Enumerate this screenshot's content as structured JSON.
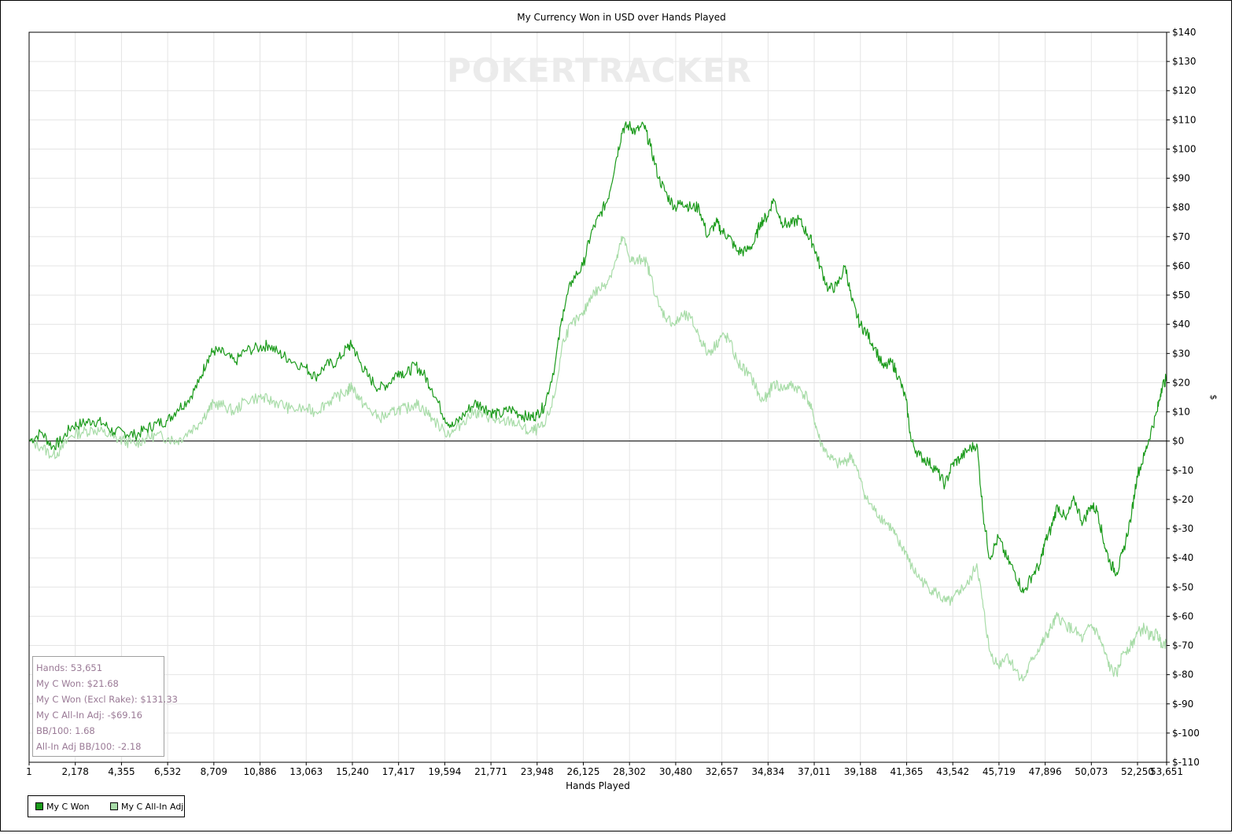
{
  "colors": {
    "won": "#1a9a1a",
    "allin": "#a8dca8",
    "grid": "#e4e4e4",
    "stats_text": "#9a7a96",
    "watermark": "#ebebeb"
  },
  "watermark": "POKERTRACKER",
  "chart_data": {
    "type": "line",
    "title": "My Currency Won in USD over Hands Played",
    "xlabel": "Hands Played",
    "ylabel": "$",
    "xlim": [
      1,
      53651
    ],
    "ylim": [
      -110,
      140
    ],
    "x_ticks": [
      "1",
      "2,178",
      "4,355",
      "6,532",
      "8,709",
      "10,886",
      "13,063",
      "15,240",
      "17,417",
      "19,594",
      "21,771",
      "23,948",
      "26,125",
      "28,302",
      "30,480",
      "32,657",
      "34,834",
      "37,011",
      "39,188",
      "41,365",
      "43,542",
      "45,719",
      "47,896",
      "50,073",
      "52,250",
      "53,651"
    ],
    "y_ticks": [
      "$140",
      "$130",
      "$120",
      "$110",
      "$100",
      "$90",
      "$80",
      "$70",
      "$60",
      "$50",
      "$40",
      "$30",
      "$20",
      "$10",
      "$0",
      "$-10",
      "$-20",
      "$-30",
      "$-40",
      "$-50",
      "$-60",
      "$-70",
      "$-80",
      "$-90",
      "$-100",
      "$-110"
    ],
    "grid": true,
    "legend_position": "bottom-left",
    "series": [
      {
        "name": "My C Won",
        "points": [
          [
            1,
            0
          ],
          [
            600,
            3
          ],
          [
            1100,
            -2
          ],
          [
            1500,
            0
          ],
          [
            2000,
            5
          ],
          [
            2500,
            6
          ],
          [
            3000,
            7
          ],
          [
            3500,
            6
          ],
          [
            4000,
            3
          ],
          [
            4500,
            3
          ],
          [
            5000,
            2
          ],
          [
            5500,
            4
          ],
          [
            6000,
            6
          ],
          [
            6532,
            7
          ],
          [
            7000,
            11
          ],
          [
            7500,
            14
          ],
          [
            8000,
            20
          ],
          [
            8400,
            28
          ],
          [
            8709,
            31
          ],
          [
            9200,
            30
          ],
          [
            9700,
            27
          ],
          [
            10200,
            31
          ],
          [
            10886,
            32
          ],
          [
            11300,
            33
          ],
          [
            11800,
            30
          ],
          [
            12300,
            28
          ],
          [
            13063,
            25
          ],
          [
            13500,
            22
          ],
          [
            14000,
            26
          ],
          [
            14500,
            27
          ],
          [
            15000,
            32
          ],
          [
            15240,
            33
          ],
          [
            15600,
            27
          ],
          [
            16000,
            22
          ],
          [
            16500,
            18
          ],
          [
            17000,
            20
          ],
          [
            17417,
            24
          ],
          [
            17800,
            23
          ],
          [
            18200,
            26
          ],
          [
            18600,
            23
          ],
          [
            19000,
            18
          ],
          [
            19594,
            8
          ],
          [
            20000,
            5
          ],
          [
            20500,
            9
          ],
          [
            21000,
            13
          ],
          [
            21400,
            12
          ],
          [
            21771,
            10
          ],
          [
            22200,
            9
          ],
          [
            22700,
            11
          ],
          [
            23200,
            9
          ],
          [
            23600,
            8
          ],
          [
            23948,
            9
          ],
          [
            24300,
            12
          ],
          [
            24800,
            26
          ],
          [
            25200,
            45
          ],
          [
            25600,
            55
          ],
          [
            26125,
            60
          ],
          [
            26500,
            71
          ],
          [
            26900,
            77
          ],
          [
            27300,
            83
          ],
          [
            27700,
            97
          ],
          [
            28000,
            107
          ],
          [
            28302,
            108
          ],
          [
            28600,
            106
          ],
          [
            29000,
            108
          ],
          [
            29300,
            101
          ],
          [
            29700,
            90
          ],
          [
            30100,
            84
          ],
          [
            30480,
            80
          ],
          [
            30800,
            82
          ],
          [
            31200,
            80
          ],
          [
            31600,
            80
          ],
          [
            32000,
            70
          ],
          [
            32400,
            75
          ],
          [
            32657,
            72
          ],
          [
            33000,
            70
          ],
          [
            33400,
            65
          ],
          [
            33800,
            65
          ],
          [
            34200,
            68
          ],
          [
            34500,
            75
          ],
          [
            34834,
            77
          ],
          [
            35100,
            83
          ],
          [
            35500,
            75
          ],
          [
            35900,
            74
          ],
          [
            36300,
            76
          ],
          [
            36700,
            71
          ],
          [
            37011,
            67
          ],
          [
            37300,
            60
          ],
          [
            37700,
            52
          ],
          [
            38100,
            53
          ],
          [
            38500,
            60
          ],
          [
            38800,
            48
          ],
          [
            39188,
            40
          ],
          [
            39500,
            37
          ],
          [
            39900,
            32
          ],
          [
            40300,
            25
          ],
          [
            40700,
            27
          ],
          [
            41000,
            22
          ],
          [
            41365,
            14
          ],
          [
            41600,
            0
          ],
          [
            42000,
            -5
          ],
          [
            42400,
            -7
          ],
          [
            42800,
            -10
          ],
          [
            43200,
            -15
          ],
          [
            43542,
            -8
          ],
          [
            43900,
            -6
          ],
          [
            44300,
            -3
          ],
          [
            44700,
            -1
          ],
          [
            45000,
            -25
          ],
          [
            45300,
            -40
          ],
          [
            45719,
            -33
          ],
          [
            46100,
            -40
          ],
          [
            46500,
            -45
          ],
          [
            46900,
            -52
          ],
          [
            47300,
            -46
          ],
          [
            47700,
            -42
          ],
          [
            47896,
            -35
          ],
          [
            48200,
            -30
          ],
          [
            48500,
            -22
          ],
          [
            48900,
            -27
          ],
          [
            49300,
            -20
          ],
          [
            49700,
            -28
          ],
          [
            50073,
            -22
          ],
          [
            50400,
            -24
          ],
          [
            50700,
            -35
          ],
          [
            51000,
            -42
          ],
          [
            51300,
            -45
          ],
          [
            51600,
            -38
          ],
          [
            52000,
            -25
          ],
          [
            52250,
            -12
          ],
          [
            52600,
            -5
          ],
          [
            52900,
            3
          ],
          [
            53200,
            10
          ],
          [
            53400,
            18
          ],
          [
            53651,
            21.68
          ]
        ]
      },
      {
        "name": "My C All-In Adj",
        "points": [
          [
            1,
            0
          ],
          [
            600,
            -2
          ],
          [
            1100,
            -5
          ],
          [
            1500,
            -3
          ],
          [
            2000,
            2
          ],
          [
            2500,
            3
          ],
          [
            3000,
            4
          ],
          [
            3500,
            3
          ],
          [
            4000,
            1
          ],
          [
            4500,
            0
          ],
          [
            5000,
            -1
          ],
          [
            5500,
            1
          ],
          [
            6000,
            2
          ],
          [
            6532,
            1
          ],
          [
            7000,
            0
          ],
          [
            7500,
            3
          ],
          [
            8000,
            6
          ],
          [
            8400,
            10
          ],
          [
            8709,
            13
          ],
          [
            9200,
            12
          ],
          [
            9700,
            10
          ],
          [
            10200,
            14
          ],
          [
            10886,
            15
          ],
          [
            11300,
            14
          ],
          [
            11800,
            13
          ],
          [
            12300,
            11
          ],
          [
            13063,
            11
          ],
          [
            13500,
            10
          ],
          [
            14000,
            13
          ],
          [
            14500,
            15
          ],
          [
            15000,
            17
          ],
          [
            15240,
            19
          ],
          [
            15600,
            14
          ],
          [
            16000,
            11
          ],
          [
            16500,
            8
          ],
          [
            17000,
            9
          ],
          [
            17417,
            11
          ],
          [
            17800,
            11
          ],
          [
            18200,
            13
          ],
          [
            18600,
            11
          ],
          [
            19000,
            8
          ],
          [
            19594,
            3
          ],
          [
            20000,
            3
          ],
          [
            20500,
            7
          ],
          [
            21000,
            10
          ],
          [
            21400,
            9
          ],
          [
            21771,
            8
          ],
          [
            22200,
            6
          ],
          [
            22700,
            7
          ],
          [
            23200,
            5
          ],
          [
            23600,
            3
          ],
          [
            23948,
            4
          ],
          [
            24300,
            5
          ],
          [
            24800,
            16
          ],
          [
            25200,
            35
          ],
          [
            25600,
            40
          ],
          [
            26125,
            43
          ],
          [
            26500,
            50
          ],
          [
            26900,
            52
          ],
          [
            27300,
            55
          ],
          [
            27700,
            62
          ],
          [
            28000,
            70
          ],
          [
            28302,
            63
          ],
          [
            28600,
            61
          ],
          [
            29000,
            63
          ],
          [
            29300,
            57
          ],
          [
            29700,
            46
          ],
          [
            30100,
            42
          ],
          [
            30480,
            40
          ],
          [
            30800,
            43
          ],
          [
            31200,
            42
          ],
          [
            31600,
            36
          ],
          [
            32000,
            30
          ],
          [
            32400,
            33
          ],
          [
            32657,
            36
          ],
          [
            33000,
            35
          ],
          [
            33400,
            27
          ],
          [
            33800,
            24
          ],
          [
            34200,
            20
          ],
          [
            34500,
            14
          ],
          [
            34834,
            15
          ],
          [
            35100,
            20
          ],
          [
            35500,
            18
          ],
          [
            35900,
            19
          ],
          [
            36300,
            18
          ],
          [
            36700,
            15
          ],
          [
            37011,
            8
          ],
          [
            37300,
            0
          ],
          [
            37700,
            -5
          ],
          [
            38100,
            -8
          ],
          [
            38500,
            -7
          ],
          [
            38800,
            -5
          ],
          [
            39188,
            -13
          ],
          [
            39500,
            -20
          ],
          [
            39900,
            -24
          ],
          [
            40300,
            -27
          ],
          [
            40700,
            -30
          ],
          [
            41000,
            -35
          ],
          [
            41365,
            -38
          ],
          [
            41600,
            -43
          ],
          [
            42000,
            -47
          ],
          [
            42400,
            -50
          ],
          [
            42800,
            -52
          ],
          [
            43200,
            -55
          ],
          [
            43542,
            -55
          ],
          [
            43900,
            -51
          ],
          [
            44300,
            -49
          ],
          [
            44700,
            -42
          ],
          [
            45000,
            -57
          ],
          [
            45300,
            -72
          ],
          [
            45719,
            -77
          ],
          [
            46100,
            -73
          ],
          [
            46500,
            -78
          ],
          [
            46900,
            -82
          ],
          [
            47300,
            -75
          ],
          [
            47700,
            -70
          ],
          [
            47896,
            -68
          ],
          [
            48200,
            -64
          ],
          [
            48500,
            -60
          ],
          [
            48900,
            -63
          ],
          [
            49300,
            -65
          ],
          [
            49700,
            -68
          ],
          [
            50073,
            -63
          ],
          [
            50400,
            -66
          ],
          [
            50700,
            -72
          ],
          [
            51000,
            -78
          ],
          [
            51300,
            -80
          ],
          [
            51600,
            -72
          ],
          [
            52000,
            -70
          ],
          [
            52250,
            -66
          ],
          [
            52600,
            -64
          ],
          [
            52900,
            -67
          ],
          [
            53200,
            -66
          ],
          [
            53400,
            -69
          ],
          [
            53651,
            -69.16
          ]
        ]
      }
    ]
  },
  "stats": {
    "hands": "Hands: 53,651",
    "won": "My C Won: $21.68",
    "won_excl_rake": "My C Won (Excl Rake): $131.33",
    "allin_adj": "My C All-In Adj: -$69.16",
    "bb100": "BB/100: 1.68",
    "allin_bb100": "All-In Adj BB/100: -2.18"
  },
  "legend": [
    {
      "label": "My C Won"
    },
    {
      "label": "My C All-In Adj"
    }
  ]
}
